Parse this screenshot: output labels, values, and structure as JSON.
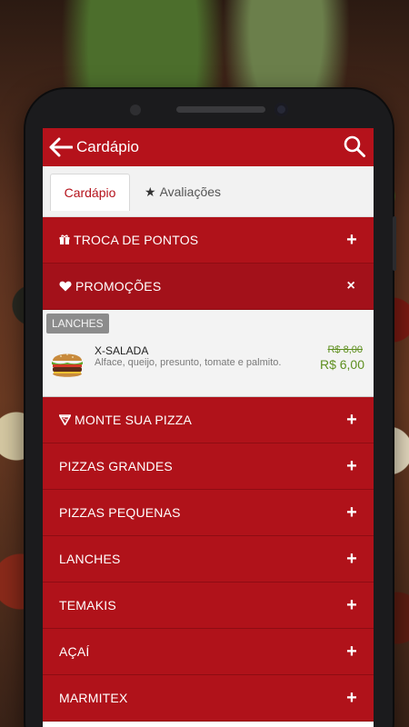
{
  "appbar": {
    "title": "Cardápio",
    "back_icon": "arrow-left-icon",
    "search_icon": "search-icon"
  },
  "tabs": [
    {
      "label": "Cardápio",
      "active": true
    },
    {
      "label": "Avaliações",
      "icon": "star-icon",
      "active": false
    }
  ],
  "sections": {
    "troca": {
      "label": "TROCA DE PONTOS",
      "icon": "gift-icon",
      "action": "+"
    },
    "promocoes": {
      "label": "PROMOÇÕES",
      "icon": "heart-icon",
      "action": "×"
    },
    "monte": {
      "label": "MONTE SUA PIZZA",
      "icon": "pizza-slice-icon",
      "action": "+"
    },
    "pizzas_grandes": {
      "label": "PIZZAS GRANDES",
      "action": "+"
    },
    "pizzas_pequenas": {
      "label": "PIZZAS PEQUENAS",
      "action": "+"
    },
    "lanches": {
      "label": "LANCHES",
      "action": "+"
    },
    "temakis": {
      "label": "TEMAKIS",
      "action": "+"
    },
    "acai": {
      "label": "AÇAÍ",
      "action": "+"
    },
    "marmitex": {
      "label": "MARMITEX",
      "action": "+"
    }
  },
  "promo_item": {
    "badge": "LANCHES",
    "name": "X-SALADA",
    "description": "Alface, queijo, presunto, tomate e palmito.",
    "old_price": "R$ 8,00",
    "new_price": "R$ 6,00"
  },
  "colors": {
    "primary": "#b5121b",
    "price_green": "#5e8f1f"
  }
}
